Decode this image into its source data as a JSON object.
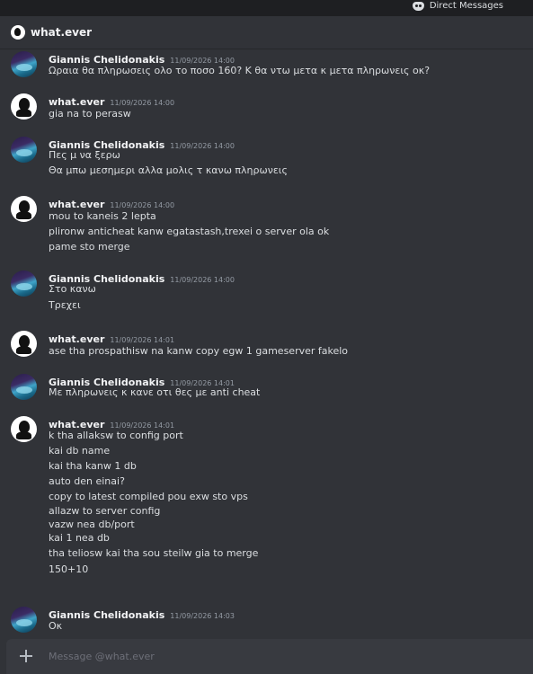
{
  "topbar": {
    "dm_label": "Direct Messages",
    "dm_icon": "discord-icon"
  },
  "channel": {
    "name": "what.ever"
  },
  "composer": {
    "placeholder": "Message @what.ever"
  },
  "messages": [
    {
      "author": "Giannis Chelidonakis",
      "avatar": "gc",
      "time": "11/09/2026 14:00",
      "lines": [
        "Ωραια θα πληρωσεις ολο το ποσο 160? Κ θα ντω μετα κ μετα πληρωνεις οκ?"
      ]
    },
    {
      "author": "what.ever",
      "avatar": "we",
      "time": "11/09/2026 14:00",
      "lines": [
        "gia na to perasw"
      ]
    },
    {
      "author": "Giannis Chelidonakis",
      "avatar": "gc",
      "time": "11/09/2026 14:00",
      "lines": [
        "Πες μ να ξερω",
        "Θα μπω μεσημερι αλλα μολις τ κανω πληρωνεις"
      ]
    },
    {
      "author": "what.ever",
      "avatar": "we",
      "time": "11/09/2026 14:00",
      "lines": [
        "mou to kaneis 2 lepta",
        "plironw anticheat kanw egatastash,trexei o server ola ok",
        "pame sto merge"
      ]
    },
    {
      "author": "Giannis Chelidonakis",
      "avatar": "gc",
      "time": "11/09/2026 14:00",
      "lines": [
        "Στο κανω",
        "Τρεχει"
      ]
    },
    {
      "author": "what.ever",
      "avatar": "we",
      "time": "11/09/2026 14:01",
      "lines": [
        "ase tha prospathisw na kanw copy egw 1 gameserver fakelo"
      ]
    },
    {
      "author": "Giannis Chelidonakis",
      "avatar": "gc",
      "time": "11/09/2026 14:01",
      "lines": [
        "Με πληρωνεις κ κανε οτι θες με anti cheat"
      ]
    },
    {
      "author": "what.ever",
      "avatar": "we",
      "time": "11/09/2026 14:01",
      "lines": [
        "k tha allaksw to config port",
        "kai db name",
        "kai tha kanw 1 db",
        "auto den einai?",
        "copy to latest compiled pou exw sto vps",
        "allazw to server config",
        "vazw nea db/port",
        "kai 1 nea db",
        "tha teliosw kai tha sou steilw gia to merge",
        "150+10"
      ]
    },
    {
      "author": "Giannis Chelidonakis",
      "avatar": "gc",
      "time": "11/09/2026 14:03",
      "lines": [
        "Οκ"
      ]
    }
  ]
}
